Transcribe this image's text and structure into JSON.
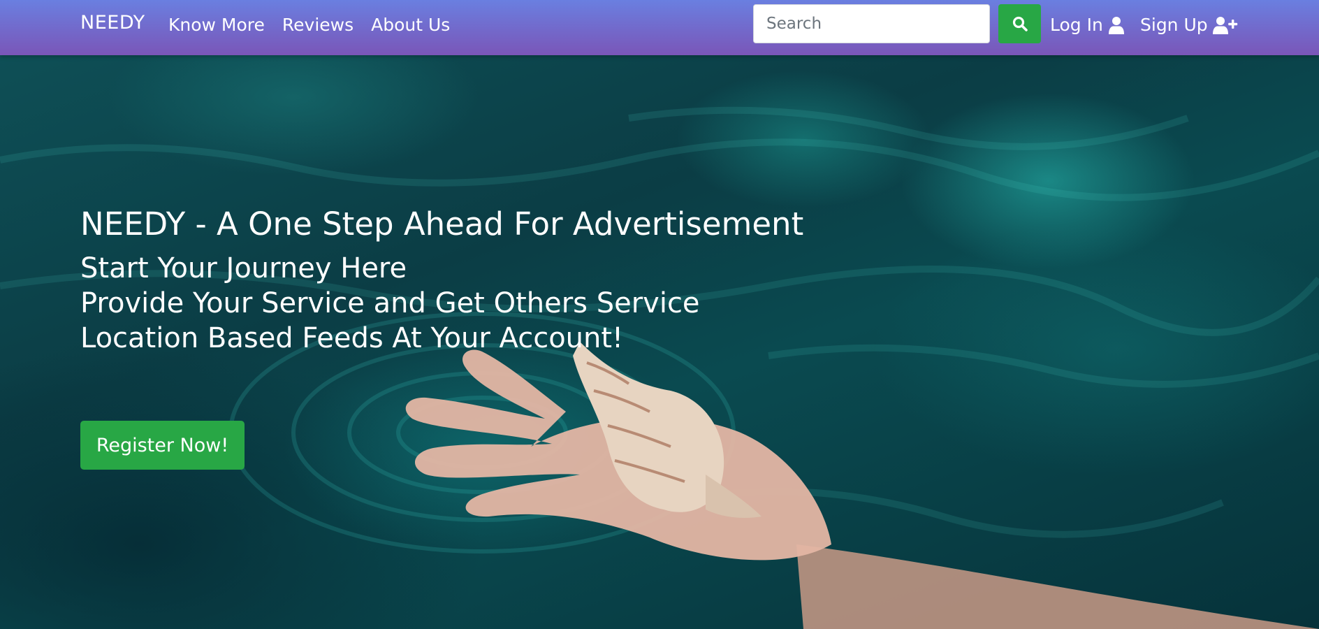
{
  "navbar": {
    "brand": "NEEDY",
    "links": [
      {
        "label": "Know More"
      },
      {
        "label": "Reviews"
      },
      {
        "label": "About Us"
      }
    ],
    "search": {
      "placeholder": "Search",
      "value": ""
    },
    "login_label": "Log In",
    "signup_label": "Sign Up"
  },
  "hero": {
    "title": "NEEDY - A One Step Ahead For Advertisement",
    "lines": [
      "Start Your Journey Here",
      "Provide Your Service and Get Others Service",
      "Location Based Feeds At Your Account!"
    ],
    "cta_label": "Register Now!"
  },
  "colors": {
    "navbar_top": "#6a7fe0",
    "navbar_bottom": "#7a56b8",
    "accent_green": "#28a745",
    "water": "#0b3d45"
  },
  "icons": {
    "search": "search-icon",
    "login": "user-icon",
    "signup": "user-plus-icon"
  }
}
